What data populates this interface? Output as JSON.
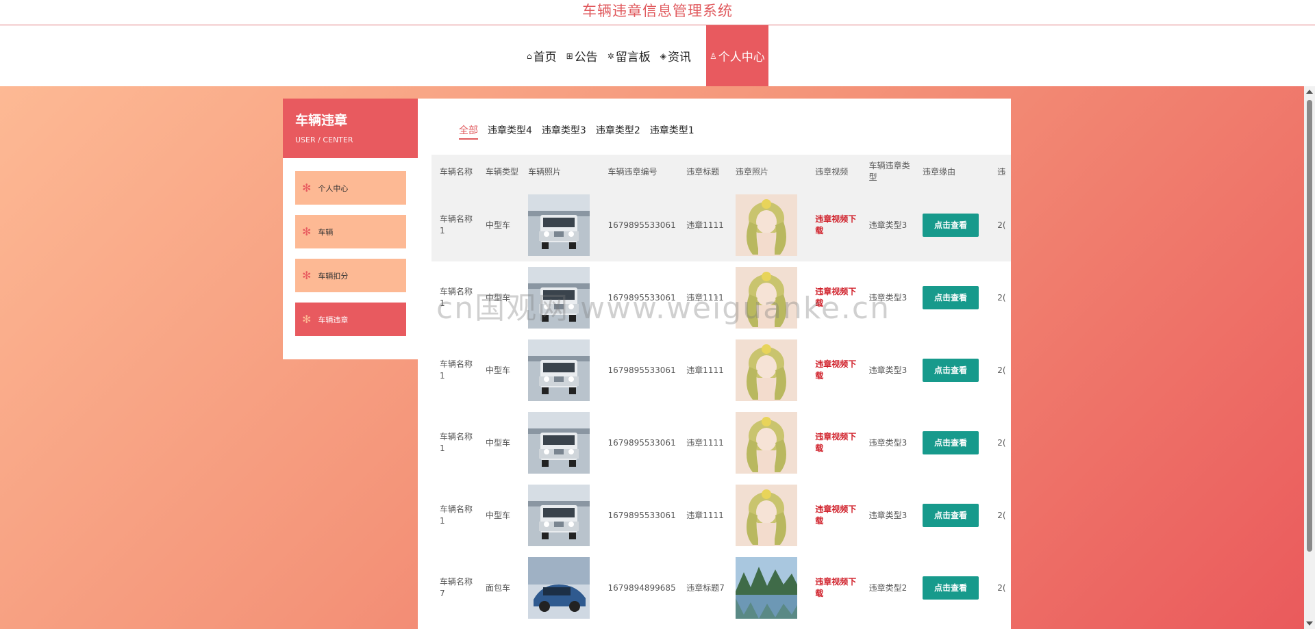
{
  "app": {
    "title": "车辆违章信息管理系统"
  },
  "nav": {
    "items": [
      {
        "icon": "home-icon",
        "glyph": "⌂",
        "label": "首页"
      },
      {
        "icon": "gift-icon",
        "glyph": "⊞",
        "label": "公告"
      },
      {
        "icon": "sparkle-icon",
        "glyph": "✲",
        "label": "留言板"
      },
      {
        "icon": "layers-icon",
        "glyph": "◈",
        "label": "资讯"
      },
      {
        "icon": "user-icon",
        "glyph": "♙",
        "label": "个人中心"
      }
    ]
  },
  "sidebar": {
    "title": "车辆违章",
    "subtitle": "USER / CENTER",
    "items": [
      {
        "label": "个人中心"
      },
      {
        "label": "车辆"
      },
      {
        "label": "车辆扣分"
      },
      {
        "label": "车辆违章"
      }
    ]
  },
  "categories": [
    "全部",
    "违章类型4",
    "违章类型3",
    "违章类型2",
    "违章类型1"
  ],
  "table": {
    "headers": [
      "车辆名称",
      "车辆类型",
      "车辆照片",
      "车辆违章编号",
      "违章标题",
      "违章照片",
      "违章视频",
      "车辆违章类型",
      "违章缘由",
      "违"
    ],
    "rows": [
      {
        "name": "车辆名称1",
        "type": "中型车",
        "number": "1679895533061",
        "title": "违章1111",
        "video": "违章视频下载",
        "vtype": "违章类型3",
        "action": "点击查看",
        "extra": "2("
      },
      {
        "name": "车辆名称1",
        "type": "中型车",
        "number": "1679895533061",
        "title": "违章1111",
        "video": "违章视频下载",
        "vtype": "违章类型3",
        "action": "点击查看",
        "extra": "2("
      },
      {
        "name": "车辆名称1",
        "type": "中型车",
        "number": "1679895533061",
        "title": "违章1111",
        "video": "违章视频下载",
        "vtype": "违章类型3",
        "action": "点击查看",
        "extra": "2("
      },
      {
        "name": "车辆名称1",
        "type": "中型车",
        "number": "1679895533061",
        "title": "违章1111",
        "video": "违章视频下载",
        "vtype": "违章类型3",
        "action": "点击查看",
        "extra": "2("
      },
      {
        "name": "车辆名称1",
        "type": "中型车",
        "number": "1679895533061",
        "title": "违章1111",
        "video": "违章视频下载",
        "vtype": "违章类型3",
        "action": "点击查看",
        "extra": "2("
      },
      {
        "name": "车辆名称7",
        "type": "面包车",
        "number": "1679894899685",
        "title": "违章标题7",
        "video": "违章视频下载",
        "vtype": "违章类型2",
        "action": "点击查看",
        "extra": "2("
      }
    ]
  },
  "watermark": "cn国观网 www.weiguanke.cn"
}
